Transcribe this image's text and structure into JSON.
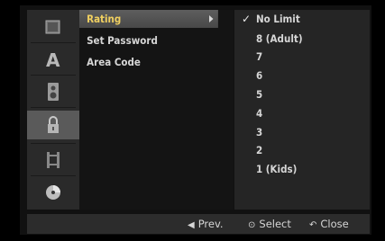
{
  "sidebar": {
    "items": [
      {
        "icon": "film-clip-icon",
        "selected": false
      },
      {
        "icon": "font-letter-icon",
        "selected": false
      },
      {
        "icon": "speaker-icon",
        "selected": false
      },
      {
        "icon": "padlock-icon",
        "selected": true
      },
      {
        "icon": "film-strip-icon",
        "selected": false
      },
      {
        "icon": "disc-icon",
        "selected": false
      }
    ]
  },
  "menu": {
    "items": [
      {
        "label": "Rating",
        "active": true
      },
      {
        "label": "Set Password",
        "active": false
      },
      {
        "label": "Area Code",
        "active": false
      }
    ]
  },
  "rating_options": {
    "selected": "No Limit",
    "items": [
      "No Limit",
      "8 (Adult)",
      "7",
      "6",
      "5",
      "4",
      "3",
      "2",
      "1 (Kids)"
    ]
  },
  "footer": {
    "prev": "Prev.",
    "select": "Select",
    "close": "Close"
  },
  "colors": {
    "highlight_text": "#f0d060",
    "text": "#d6d6d6",
    "panel": "#252525"
  }
}
